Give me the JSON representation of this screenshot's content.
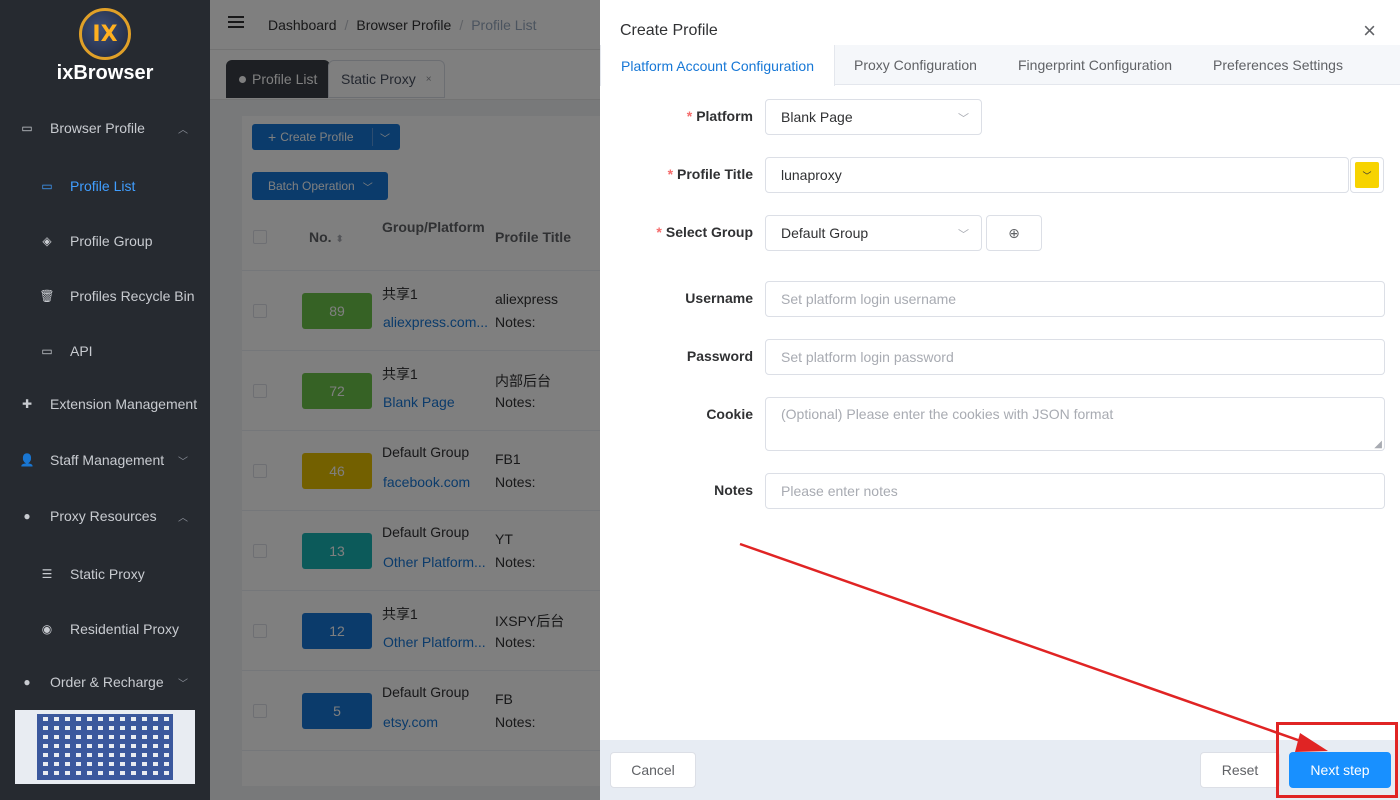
{
  "brand": {
    "logo_text": "ixBrowser",
    "logo_mark": "IX"
  },
  "sidebar": {
    "items": [
      {
        "label": "Browser Profile",
        "icon": "calendar-icon",
        "chevron": "up"
      },
      {
        "label": "Profile List",
        "icon": "calendar-icon",
        "active": true
      },
      {
        "label": "Profile Group",
        "icon": "layers-icon"
      },
      {
        "label": "Profiles Recycle Bin",
        "icon": "trash-icon"
      },
      {
        "label": "API",
        "icon": "calendar-icon"
      },
      {
        "label": "Extension Management",
        "icon": "puzzle-icon"
      },
      {
        "label": "Staff Management",
        "icon": "user-icon",
        "chevron": "down"
      },
      {
        "label": "Proxy Resources",
        "icon": "globe-icon",
        "chevron": "up"
      },
      {
        "label": "Static Proxy",
        "icon": "list-icon"
      },
      {
        "label": "Residential Proxy",
        "icon": "dashboard-icon"
      },
      {
        "label": "Order & Recharge",
        "icon": "coin-icon",
        "chevron": "down"
      }
    ]
  },
  "breadcrumb": {
    "items": [
      "Dashboard",
      "Browser Profile",
      "Profile List"
    ]
  },
  "tabs": [
    {
      "label": "Profile List",
      "active": true
    },
    {
      "label": "Static Proxy",
      "close": "×"
    }
  ],
  "toolbar": {
    "create_label": "Create Profile",
    "batch_label": "Batch Operation"
  },
  "table": {
    "headers": {
      "no": "No.",
      "group": "Group/Platform",
      "title": "Profile Title"
    },
    "rows": [
      {
        "no": "89",
        "color": "#67c23a",
        "group": "共享1",
        "platform": "aliexpress.com...",
        "title": "aliexpress",
        "notes": "Notes:"
      },
      {
        "no": "72",
        "color": "#67c23a",
        "group": "共享1",
        "platform": "Blank Page",
        "title": "内部后台",
        "notes": "Notes:"
      },
      {
        "no": "46",
        "color": "#e6c000",
        "group": "Default Group",
        "platform": "facebook.com",
        "title": "FB1",
        "notes": "Notes:"
      },
      {
        "no": "13",
        "color": "#1ab1b1",
        "group": "Default Group",
        "platform": "Other Platform...",
        "title": "YT",
        "notes": "Notes:"
      },
      {
        "no": "12",
        "color": "#1677d6",
        "group": "共享1",
        "platform": "Other Platform...",
        "title": "IXSPY后台",
        "notes": "Notes:"
      },
      {
        "no": "5",
        "color": "#1677d6",
        "group": "Default Group",
        "platform": "etsy.com",
        "title": "FB",
        "notes": "Notes:"
      }
    ]
  },
  "drawer": {
    "title": "Create Profile",
    "close_symbol": "×",
    "tabs": [
      "Platform Account Configuration",
      "Proxy Configuration",
      "Fingerprint Configuration",
      "Preferences Settings"
    ],
    "form": {
      "platform": {
        "label": "Platform",
        "value": "Blank Page"
      },
      "profile_title": {
        "label": "Profile Title",
        "value": "lunaproxy",
        "color": "#f7d300"
      },
      "group": {
        "label": "Select Group",
        "value": "Default Group"
      },
      "username": {
        "label": "Username",
        "placeholder": "Set platform login username"
      },
      "password": {
        "label": "Password",
        "placeholder": "Set platform login password"
      },
      "cookie": {
        "label": "Cookie",
        "placeholder": "(Optional) Please enter the cookies with JSON format"
      },
      "notes": {
        "label": "Notes",
        "placeholder": "Please enter notes"
      }
    },
    "footer": {
      "cancel": "Cancel",
      "reset": "Reset",
      "next": "Next step"
    }
  },
  "colors": {
    "accent": "#1677d6",
    "annotation": "#e02424",
    "sidebar_bg": "#262a30"
  }
}
